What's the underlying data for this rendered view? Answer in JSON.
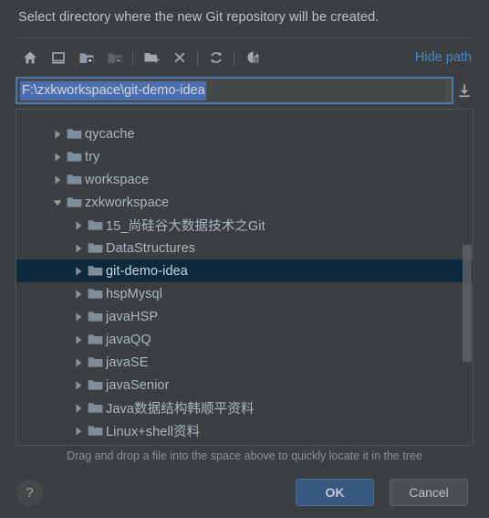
{
  "dialog": {
    "title": "Select directory where the new Git repository will be created.",
    "drag_hint": "Drag and drop a file into the space above to quickly locate it in the tree"
  },
  "toolbar": {
    "hide_path_label": "Hide path",
    "buttons": [
      {
        "name": "home-icon",
        "tooltip": "Home"
      },
      {
        "name": "desktop-icon",
        "tooltip": "Desktop"
      },
      {
        "name": "project-folder-icon",
        "tooltip": "Project Directory"
      },
      {
        "name": "module-folder-icon",
        "tooltip": "Module Directory"
      },
      {
        "name": "new-folder-icon",
        "tooltip": "New Folder"
      },
      {
        "name": "delete-icon",
        "tooltip": "Delete"
      },
      {
        "name": "refresh-icon",
        "tooltip": "Refresh"
      },
      {
        "name": "show-hidden-icon",
        "tooltip": "Show Hidden Files and Directories"
      }
    ]
  },
  "path": {
    "value": "F:\\zxkworkspace\\git-demo-idea",
    "placeholder": "",
    "import_icon": "download-arrow-icon"
  },
  "tree": {
    "rows": [
      {
        "label": "",
        "depth": 1,
        "expanded": false,
        "selected": false,
        "clipped": true
      },
      {
        "label": "qycache",
        "depth": 1,
        "expanded": false,
        "selected": false
      },
      {
        "label": "try",
        "depth": 1,
        "expanded": false,
        "selected": false
      },
      {
        "label": "workspace",
        "depth": 1,
        "expanded": false,
        "selected": false
      },
      {
        "label": "zxkworkspace",
        "depth": 1,
        "expanded": true,
        "selected": false
      },
      {
        "label": "15_尚硅谷大数据技术之Git",
        "depth": 2,
        "expanded": false,
        "selected": false
      },
      {
        "label": "DataStructures",
        "depth": 2,
        "expanded": false,
        "selected": false
      },
      {
        "label": "git-demo-idea",
        "depth": 2,
        "expanded": false,
        "selected": true
      },
      {
        "label": "hspMysql",
        "depth": 2,
        "expanded": false,
        "selected": false
      },
      {
        "label": "javaHSP",
        "depth": 2,
        "expanded": false,
        "selected": false
      },
      {
        "label": "javaQQ",
        "depth": 2,
        "expanded": false,
        "selected": false
      },
      {
        "label": "javaSE",
        "depth": 2,
        "expanded": false,
        "selected": false
      },
      {
        "label": "javaSenior",
        "depth": 2,
        "expanded": false,
        "selected": false
      },
      {
        "label": "Java数据结构韩顺平资料",
        "depth": 2,
        "expanded": false,
        "selected": false
      },
      {
        "label": "Linux+shell资料",
        "depth": 2,
        "expanded": false,
        "selected": false
      }
    ],
    "scrollbar": {
      "name": "vertical-scrollbar",
      "thumb_top_pct": 40,
      "thumb_height_pct": 35
    }
  },
  "footer": {
    "help_label": "?",
    "ok_label": "OK",
    "cancel_label": "Cancel"
  },
  "colors": {
    "window_bg": "#3c3f41",
    "panel_border": "#4f5355",
    "accent_link": "#4a88c7",
    "selection_bg": "#0d293e",
    "text_selection_bg": "#4b6eaf",
    "field_border": "#4a7aa8",
    "ok_button_bg": "#365880",
    "cancel_button_bg": "#4c5052",
    "tree_label": "#a9b7c6",
    "folder_icon": "#7f8c99",
    "hint_text": "#8d9194"
  }
}
